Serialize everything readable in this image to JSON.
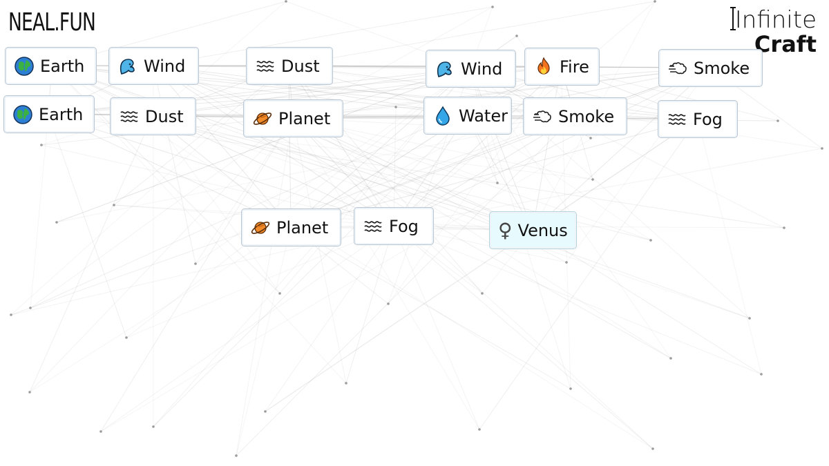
{
  "brand": {
    "left_logo": "NEAL.FUN",
    "right_logo_line1": "Infinite",
    "right_logo_line2": "Craft"
  },
  "tiles": [
    {
      "id": "earth-1",
      "label": "Earth",
      "icon": "earth-globe-icon"
    },
    {
      "id": "wind-1",
      "label": "Wind",
      "icon": "wind-face-icon"
    },
    {
      "id": "dust-1",
      "label": "Dust",
      "icon": "wavy-dust-icon"
    },
    {
      "id": "wind-2",
      "label": "Wind",
      "icon": "wind-face-icon"
    },
    {
      "id": "fire-1",
      "label": "Fire",
      "icon": "fire-icon"
    },
    {
      "id": "smoke-1",
      "label": "Smoke",
      "icon": "smoke-puff-icon"
    },
    {
      "id": "earth-2",
      "label": "Earth",
      "icon": "earth-globe-icon"
    },
    {
      "id": "dust-2",
      "label": "Dust",
      "icon": "wavy-dust-icon"
    },
    {
      "id": "planet-1",
      "label": "Planet",
      "icon": "ringed-planet-icon"
    },
    {
      "id": "water-1",
      "label": "Water",
      "icon": "water-drop-icon"
    },
    {
      "id": "smoke-2",
      "label": "Smoke",
      "icon": "smoke-puff-icon"
    },
    {
      "id": "fog-1",
      "label": "Fog",
      "icon": "wavy-fog-icon"
    },
    {
      "id": "planet-2",
      "label": "Planet",
      "icon": "ringed-planet-icon"
    },
    {
      "id": "fog-2",
      "label": "Fog",
      "icon": "wavy-fog-icon"
    },
    {
      "id": "venus-1",
      "label": "Venus",
      "icon": "venus-symbol-icon"
    }
  ]
}
